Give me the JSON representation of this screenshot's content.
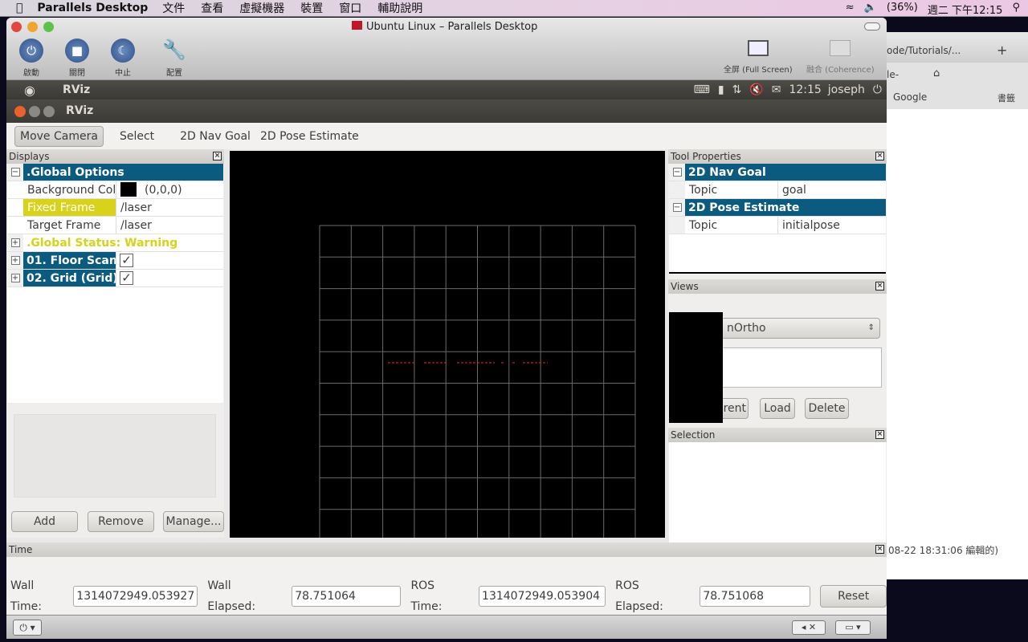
{
  "menubar": {
    "app": "Parallels Desktop",
    "items": [
      "文件",
      "查看",
      "虛擬機器",
      "裝置",
      "窗口",
      "輔助說明"
    ],
    "battery": "(36%)",
    "clock": "週二 下午12:15"
  },
  "browser": {
    "tab": "ode/Tutorials/...",
    "search": "le-",
    "bookmark_google": "Google",
    "bookmarks": "書籤",
    "footer": "08-22 18:31:06 編輯的)"
  },
  "parallels": {
    "title": "Ubuntu Linux – Parallels Desktop",
    "buttons": [
      "啟動",
      "關閉",
      "中止",
      "配置"
    ],
    "fullscreen": "全屏 (Full Screen)",
    "coherence": "融合 (Coherence)"
  },
  "ubuntu_panel": {
    "app": "RViz",
    "time": "12:15",
    "user": "joseph"
  },
  "rviz": {
    "title": "RViz",
    "tools": [
      "Move Camera",
      "Select",
      "2D Nav Goal",
      "2D Pose Estimate"
    ],
    "displays": {
      "title": "Displays",
      "global_options": ".Global Options",
      "bg_label": "Background Colo",
      "bg_value": "(0,0,0)",
      "bg_color": "#000000",
      "fixed_label": "Fixed Frame",
      "fixed_value": "/laser",
      "target_label": "Target Frame",
      "target_value": "/laser",
      "status": ".Global Status: Warning",
      "items": [
        {
          "label": "01. Floor Scan (",
          "checked": true
        },
        {
          "label": "02. Grid (Grid)",
          "checked": true
        }
      ],
      "add": "Add",
      "remove": "Remove",
      "manage": "Manage..."
    },
    "tool_props": {
      "title": "Tool Properties",
      "groups": [
        {
          "name": "2D Nav Goal",
          "key": "Topic",
          "value": "goal"
        },
        {
          "name": "2D Pose Estimate",
          "key": "Topic",
          "value": "initialpose"
        }
      ]
    },
    "views": {
      "title": "Views",
      "selected": "nOrtho",
      "current": "rent",
      "load": "Load",
      "delete": "Delete"
    },
    "selection": {
      "title": "Selection"
    },
    "time": {
      "title": "Time",
      "wall_time_label": "Wall Time:",
      "wall_time": "1314072949.053927",
      "wall_elapsed_label": "Wall Elapsed:",
      "wall_elapsed": "78.751064",
      "ros_time_label": "ROS Time:",
      "ros_time": "1314072949.053904",
      "ros_elapsed_label": "ROS Elapsed:",
      "ros_elapsed": "78.751068",
      "reset": "Reset"
    }
  },
  "colors": {
    "header": "#0b5a80",
    "warning": "#d9d21a",
    "scan": "#ff2020"
  }
}
